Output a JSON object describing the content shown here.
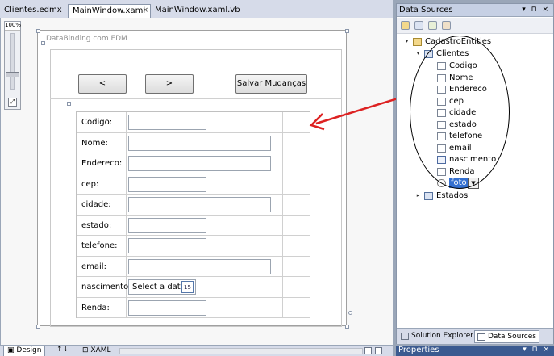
{
  "doc_tabs": [
    {
      "label": "Clientes.edmx"
    },
    {
      "label": "MainWindow.xaml",
      "active": true
    },
    {
      "label": "MainWindow.xaml.vb"
    }
  ],
  "close_glyph": "×",
  "zoom": {
    "label": "100%"
  },
  "window": {
    "title": "DataBinding com EDM"
  },
  "nav_buttons": {
    "prev_label": "<",
    "next_label": ">",
    "save_label": "Salvar Mudanças"
  },
  "form": {
    "fields": [
      {
        "label": "Codigo:",
        "kind": "short"
      },
      {
        "label": "Nome:",
        "kind": "long"
      },
      {
        "label": "Endereco:",
        "kind": "long"
      },
      {
        "label": "cep:",
        "kind": "short"
      },
      {
        "label": "cidade:",
        "kind": "long"
      },
      {
        "label": "estado:",
        "kind": "short"
      },
      {
        "label": "telefone:",
        "kind": "short"
      },
      {
        "label": "email:",
        "kind": "long"
      },
      {
        "label": "nascimento:",
        "kind": "date"
      },
      {
        "label": "Renda:",
        "kind": "short"
      }
    ],
    "date_placeholder": "Select a date",
    "calendar_day": "15"
  },
  "bottom_bar": {
    "design_tab": "Design",
    "swap_glyph": "↑↓",
    "xaml_tab": "XAML"
  },
  "data_sources": {
    "title": "Data Sources",
    "header_icons": "▾ ⊓ ×",
    "tree": {
      "root": "CadastroEntities",
      "table": "Clientes",
      "fields": [
        {
          "label": "Codigo",
          "icon": "field"
        },
        {
          "label": "Nome",
          "icon": "field"
        },
        {
          "label": "Endereco",
          "icon": "field"
        },
        {
          "label": "cep",
          "icon": "field"
        },
        {
          "label": "cidade",
          "icon": "field"
        },
        {
          "label": "estado",
          "icon": "field"
        },
        {
          "label": "telefone",
          "icon": "field"
        },
        {
          "label": "email",
          "icon": "field"
        },
        {
          "label": "nascimento",
          "icon": "calendar"
        },
        {
          "label": "Renda",
          "icon": "field"
        },
        {
          "label": "foto",
          "icon": "blocked",
          "selected": true
        }
      ],
      "sibling_table": "Estados"
    },
    "panel_tabs": [
      {
        "label": "Solution Explorer"
      },
      {
        "label": "Data Sources",
        "active": true
      }
    ]
  },
  "properties": {
    "title": "Properties",
    "header_icons": "▾ ⊓ ×"
  },
  "colors": {
    "annotation_arrow": "#dd2222",
    "selection": "#3470d0"
  }
}
